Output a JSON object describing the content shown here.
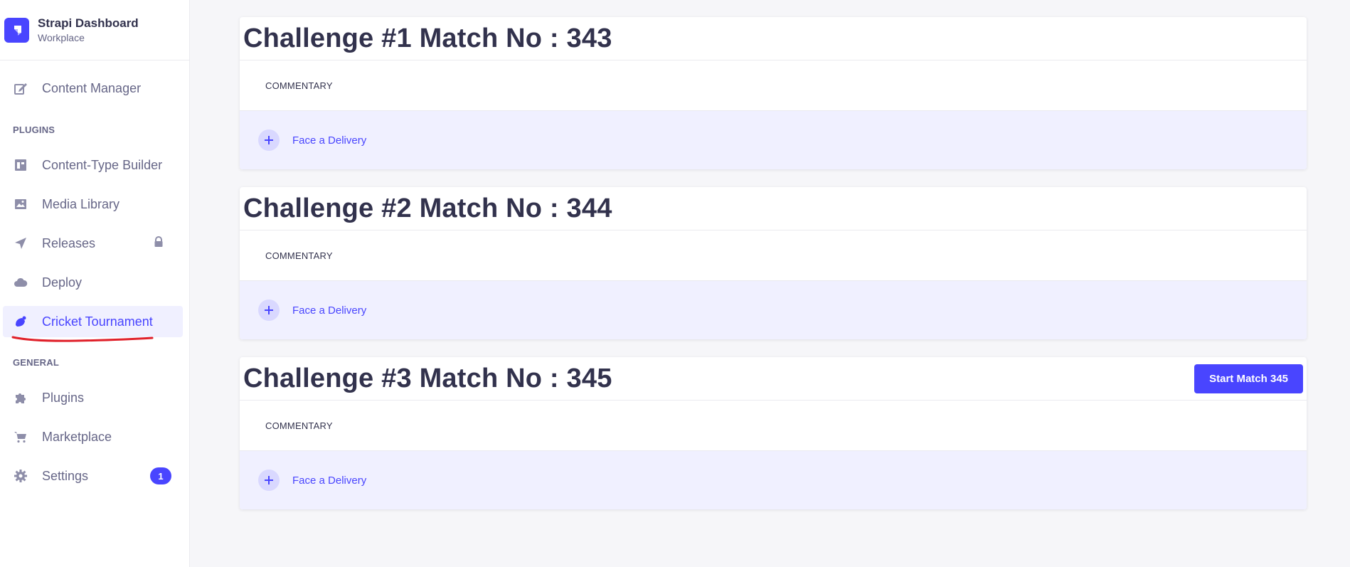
{
  "brand": {
    "title": "Strapi Dashboard",
    "subtitle": "Workplace"
  },
  "sidebar": {
    "content_manager": "Content Manager",
    "plugins_section": "PLUGINS",
    "plugins_items": [
      {
        "label": "Content-Type Builder",
        "icon": "layout-icon"
      },
      {
        "label": "Media Library",
        "icon": "image-icon"
      },
      {
        "label": "Releases",
        "icon": "paper-plane-icon",
        "locked": true
      },
      {
        "label": "Deploy",
        "icon": "cloud-icon"
      },
      {
        "label": "Cricket Tournament",
        "icon": "cricket-ball-icon",
        "active": true
      }
    ],
    "general_section": "GENERAL",
    "general_items": [
      {
        "label": "Plugins",
        "icon": "puzzle-icon"
      },
      {
        "label": "Marketplace",
        "icon": "cart-icon"
      },
      {
        "label": "Settings",
        "icon": "gear-icon",
        "badge": "1"
      }
    ]
  },
  "challenges": [
    {
      "title": "Challenge #1 Match No : 343",
      "commentary": "COMMENTARY",
      "delivery_label": "Face a Delivery"
    },
    {
      "title": "Challenge #2 Match No : 344",
      "commentary": "COMMENTARY",
      "delivery_label": "Face a Delivery"
    },
    {
      "title": "Challenge #3 Match No : 345",
      "commentary": "COMMENTARY",
      "delivery_label": "Face a Delivery",
      "start_button": "Start Match 345"
    }
  ],
  "colors": {
    "accent": "#4945ff",
    "annotation": "#e0202a"
  }
}
